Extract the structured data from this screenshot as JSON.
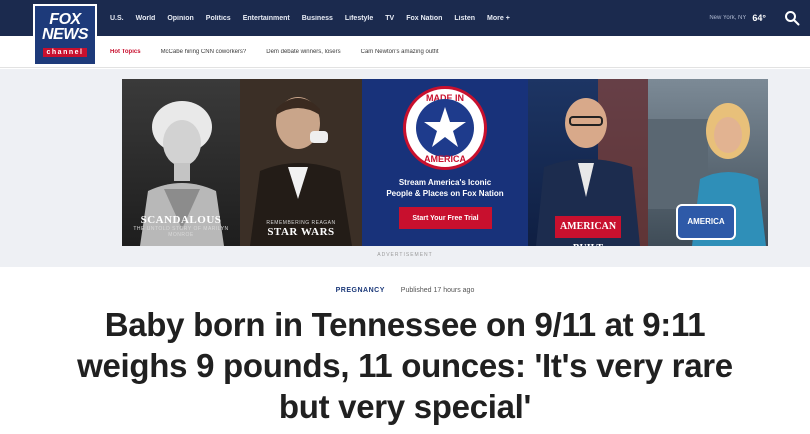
{
  "logo": {
    "line1": "FOX",
    "line2": "NEWS",
    "line3": "channel"
  },
  "nav": {
    "items": [
      "U.S.",
      "World",
      "Opinion",
      "Politics",
      "Entertainment",
      "Business",
      "Lifestyle",
      "TV",
      "Fox Nation",
      "Listen",
      "More +"
    ],
    "weather_location": "New York, NY",
    "weather_temp": "64°"
  },
  "hot_topics": {
    "label": "Hot Topics",
    "items": [
      "McCabe hiring CNN coworkers?",
      "Dem debate winners, losers",
      "Cam Newton's amazing outfit"
    ]
  },
  "ad": {
    "panel1_caption": "SCANDALOUS",
    "panel1_sub": "THE UNTOLD STORY OF MARILYN MONROE",
    "panel2_sub": "REMEMBERING REAGAN",
    "panel2_caption": "STAR WARS",
    "badge_top": "MADE IN",
    "badge_bottom": "AMERICA",
    "tagline_line1": "Stream America's Iconic",
    "tagline_line2": "People & Places on Fox Nation",
    "cta": "Start Your Free Trial",
    "panel4_caption": "AMERICAN BUILT",
    "panel5_caption": "AMERICA",
    "label": "ADVERTISEMENT"
  },
  "article": {
    "category": "PREGNANCY",
    "published": "Published 17 hours ago",
    "headline": "Baby born in Tennessee on 9/11 at 9:11 weighs 9 pounds, 11 ounces: 'It's very rare but very special'"
  },
  "colors": {
    "nav_bg": "#1b2a4e",
    "accent_red": "#c8102e",
    "logo_blue": "#1d3a7a"
  }
}
